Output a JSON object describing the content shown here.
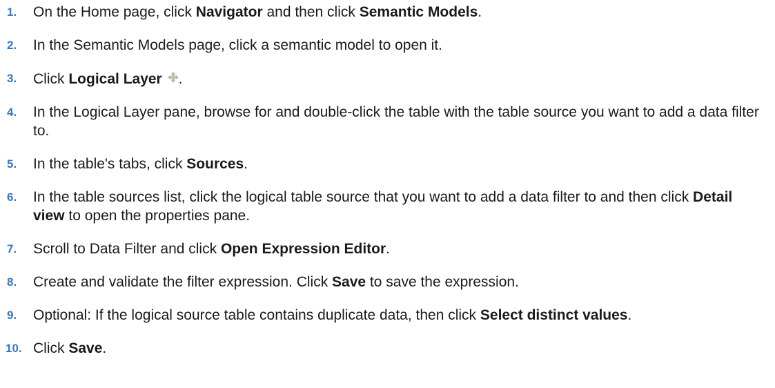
{
  "steps": [
    {
      "num": "1.",
      "parts": [
        {
          "t": "On the Home page, click "
        },
        {
          "t": "Navigator",
          "b": true
        },
        {
          "t": " and then click "
        },
        {
          "t": "Semantic Models",
          "b": true
        },
        {
          "t": "."
        }
      ]
    },
    {
      "num": "2.",
      "parts": [
        {
          "t": "In the Semantic Models page, click a semantic model to open it."
        }
      ]
    },
    {
      "num": "3.",
      "parts": [
        {
          "t": "Click "
        },
        {
          "t": "Logical Layer",
          "b": true
        },
        {
          "t": " "
        },
        {
          "icon": "logical-layer-icon"
        },
        {
          "t": "."
        }
      ]
    },
    {
      "num": "4.",
      "parts": [
        {
          "t": "In the Logical Layer pane, browse for and double-click the table with the table source you want to add a data filter to."
        }
      ]
    },
    {
      "num": "5.",
      "parts": [
        {
          "t": "In the table's tabs, click "
        },
        {
          "t": "Sources",
          "b": true
        },
        {
          "t": "."
        }
      ]
    },
    {
      "num": "6.",
      "parts": [
        {
          "t": "In the table sources list, click the logical table source that you want to add a data filter to and then click "
        },
        {
          "t": "Detail view",
          "b": true
        },
        {
          "t": " to open the properties pane."
        }
      ]
    },
    {
      "num": "7.",
      "parts": [
        {
          "t": "Scroll to Data Filter and click "
        },
        {
          "t": "Open Expression Editor",
          "b": true
        },
        {
          "t": "."
        }
      ]
    },
    {
      "num": "8.",
      "parts": [
        {
          "t": "Create and validate the filter expression. Click "
        },
        {
          "t": "Save",
          "b": true
        },
        {
          "t": " to save the expression."
        }
      ]
    },
    {
      "num": "9.",
      "parts": [
        {
          "t": "Optional: If the logical source table contains duplicate data, then click "
        },
        {
          "t": "Select distinct values",
          "b": true
        },
        {
          "t": "."
        }
      ]
    },
    {
      "num": "10.",
      "parts": [
        {
          "t": "Click "
        },
        {
          "t": "Save",
          "b": true
        },
        {
          "t": "."
        }
      ]
    }
  ],
  "colors": {
    "step_number": "#3a78b6",
    "text": "#1a1a1a"
  }
}
